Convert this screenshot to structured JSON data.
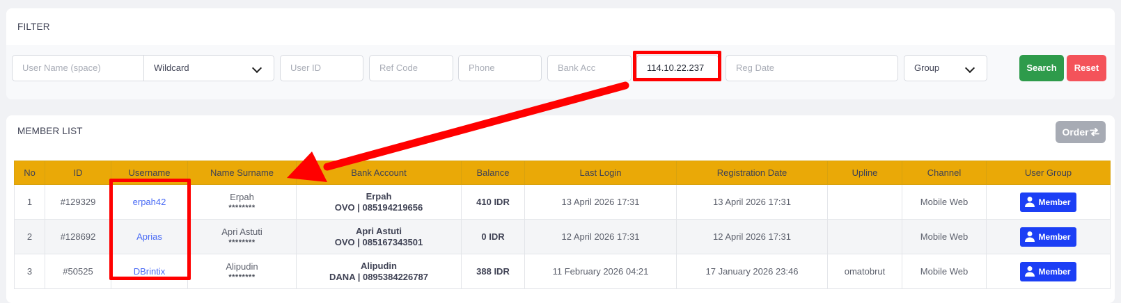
{
  "filter": {
    "title": "FILTER",
    "username_placeholder": "User Name (space)",
    "match_mode": "Wildcard",
    "user_id_placeholder": "User ID",
    "ref_code_placeholder": "Ref Code",
    "phone_placeholder": "Phone",
    "bank_acc_placeholder": "Bank Acc",
    "ip_value": "114.10.22.237",
    "reg_date_placeholder": "Reg Date",
    "group": "Group",
    "search_label": "Search",
    "reset_label": "Reset"
  },
  "member_list": {
    "title": "MEMBER LIST",
    "order_label": "Order",
    "columns": [
      "No",
      "ID",
      "Username",
      "Name Surname",
      "Bank Account",
      "Balance",
      "Last Login",
      "Registration Date",
      "Upline",
      "Channel",
      "User Group"
    ],
    "rows": [
      {
        "no": "1",
        "id": "#129329",
        "username": "erpah42",
        "name": "Erpah",
        "masked": "********",
        "bank_name": "Erpah",
        "bank_acc": "OVO | 085194219656",
        "balance": "410 IDR",
        "last_login": "13 April 2026 17:31",
        "reg_date": "13 April 2026 17:31",
        "upline": "",
        "channel": "Mobile Web",
        "group": "Member"
      },
      {
        "no": "2",
        "id": "#128692",
        "username": "Aprias",
        "name": "Apri Astuti",
        "masked": "********",
        "bank_name": "Apri Astuti",
        "bank_acc": "OVO | 085167343501",
        "balance": "0 IDR",
        "last_login": "12 April 2026 17:31",
        "reg_date": "12 April 2026 17:31",
        "upline": "",
        "channel": "Mobile Web",
        "group": "Member"
      },
      {
        "no": "3",
        "id": "#50525",
        "username": "DBrintix",
        "name": "Alipudin",
        "masked": "********",
        "bank_name": "Alipudin",
        "bank_acc": "DANA | 0895384226787",
        "balance": "388 IDR",
        "last_login": "11 February 2026 04:21",
        "reg_date": "17 January 2026 23:46",
        "upline": "omatobrut",
        "channel": "Mobile Web",
        "group": "Member"
      }
    ]
  },
  "colors": {
    "header_bg": "#eaa907",
    "search": "#2e9b4b",
    "reset": "#f4535a",
    "member_badge": "#1c3ff5",
    "annotation": "#ff0000"
  },
  "icons": [
    "chevron-down-icon",
    "sort-arrows-icon",
    "user-icon"
  ]
}
